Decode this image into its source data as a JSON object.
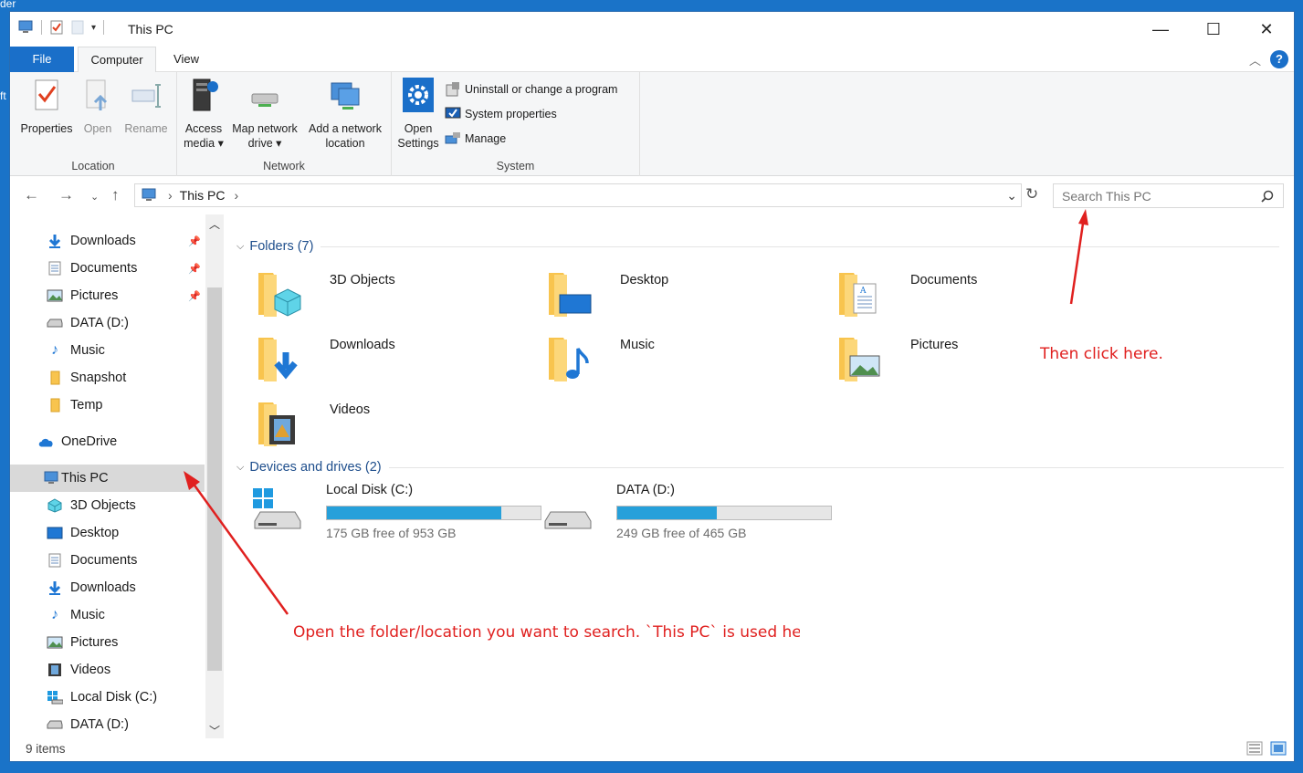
{
  "desktop": {
    "partial_text_1": "der",
    "partial_text_2": "ft"
  },
  "window": {
    "title": "This PC",
    "controls": {
      "minimize": "—",
      "maximize": "☐",
      "close": "✕"
    }
  },
  "ribbon": {
    "tabs": {
      "file": "File",
      "computer": "Computer",
      "view": "View"
    },
    "groups": {
      "location": {
        "label": "Location",
        "properties": "Properties",
        "open": "Open",
        "rename": "Rename"
      },
      "network": {
        "label": "Network",
        "access_media_1": "Access",
        "access_media_2": "media ▾",
        "map_drive_1": "Map network",
        "map_drive_2": "drive ▾",
        "add_location_1": "Add a network",
        "add_location_2": "location"
      },
      "system": {
        "label": "System",
        "open_settings_1": "Open",
        "open_settings_2": "Settings",
        "uninstall": "Uninstall or change a program",
        "system_properties": "System properties",
        "manage": "Manage"
      }
    }
  },
  "navbar": {
    "breadcrumb": "This PC",
    "search_placeholder": "Search This PC"
  },
  "navpane": {
    "items": [
      {
        "label": "Downloads",
        "pinned": true
      },
      {
        "label": "Documents",
        "pinned": true
      },
      {
        "label": "Pictures",
        "pinned": true
      },
      {
        "label": "DATA (D:)"
      },
      {
        "label": "Music"
      },
      {
        "label": "Snapshot"
      },
      {
        "label": "Temp"
      },
      {
        "label": "OneDrive"
      },
      {
        "label": "This PC",
        "selected": true
      },
      {
        "label": "3D Objects"
      },
      {
        "label": "Desktop"
      },
      {
        "label": "Documents"
      },
      {
        "label": "Downloads"
      },
      {
        "label": "Music"
      },
      {
        "label": "Pictures"
      },
      {
        "label": "Videos"
      },
      {
        "label": "Local Disk (C:)"
      },
      {
        "label": "DATA (D:)"
      }
    ]
  },
  "content": {
    "folders_header": "Folders (7)",
    "folders": [
      "3D Objects",
      "Desktop",
      "Documents",
      "Downloads",
      "Music",
      "Pictures",
      "Videos"
    ],
    "drives_header": "Devices and drives (2)",
    "drives": [
      {
        "name": "Local Disk (C:)",
        "free_text": "175 GB free of 953 GB",
        "used_fraction": 0.816
      },
      {
        "name": "DATA (D:)",
        "free_text": "249 GB free of 465 GB",
        "used_fraction": 0.465
      }
    ]
  },
  "status": {
    "item_count": "9 items"
  },
  "annotations": {
    "search_hint": "Then click here.",
    "folder_hint": "Open the folder/location you want to search.  `This PC` is used her"
  },
  "colors": {
    "accent": "#1a6fc9",
    "annotation": "#e0201f",
    "drive_fill": "#26a0da",
    "folder": "#f8c44e"
  }
}
